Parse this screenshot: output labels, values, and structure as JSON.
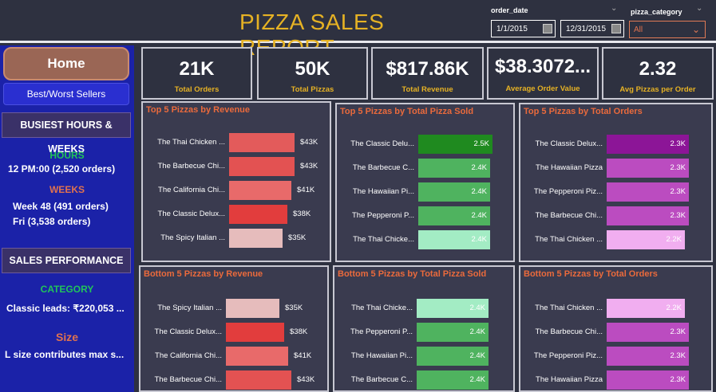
{
  "header": {
    "title": "PIZZA SALES REPORT",
    "order_date_label": "order_date",
    "date_start": "1/1/2015",
    "date_end": "12/31/2015",
    "category_label": "pizza_category",
    "category_value": "All"
  },
  "sidebar": {
    "home": "Home",
    "best_worst": "Best/Worst Sellers",
    "busiest": "BUSIEST HOURS & WEEKS",
    "hours_head": "HOURS",
    "hours_text": "12 PM:00 (2,520 orders)",
    "weeks_head": "WEEKS",
    "weeks_text1": "Week 48 (491 orders)",
    "weeks_text2": "Fri (3,538 orders)",
    "sales_perf": "SALES PERFORMANCE",
    "category_head": "CATEGORY",
    "category_text": "Classic leads: ₹220,053 ...",
    "size_head": "Size",
    "size_text": "L size contributes max s..."
  },
  "kpis": [
    {
      "value": "21K",
      "label": "Total Orders"
    },
    {
      "value": "50K",
      "label": "Total Pizzas"
    },
    {
      "value": "$817.86K",
      "label": "Total Revenue"
    },
    {
      "value": "$38.3072...",
      "label": "Average Order Value"
    },
    {
      "value": "2.32",
      "label": "Avg Pizzas per Order"
    }
  ],
  "chart_data": [
    {
      "type": "bar",
      "title": "Top 5 Pizzas by Revenue",
      "categories": [
        "The Thai Chicken ...",
        "The Barbecue Chi...",
        "The California Chi...",
        "The Classic Delux...",
        "The Spicy Italian ..."
      ],
      "values": [
        43,
        43,
        41,
        38,
        35
      ],
      "labels": [
        "$43K",
        "$43K",
        "$41K",
        "$38K",
        "$35K"
      ],
      "colors": [
        "#e35b5b",
        "#e35252",
        "#e86a6a",
        "#e23d3d",
        "#e6bcbc"
      ],
      "xlim": [
        0,
        45
      ]
    },
    {
      "type": "bar",
      "title": "Top 5 Pizzas by Total Pizza Sold",
      "categories": [
        "The Classic Delu...",
        "The Barbecue C...",
        "The Hawaiian Pi...",
        "The Pepperoni P...",
        "The Thai Chicke..."
      ],
      "values": [
        2.5,
        2.4,
        2.4,
        2.4,
        2.4
      ],
      "labels": [
        "2.5K",
        "2.4K",
        "2.4K",
        "2.4K",
        "2.4K"
      ],
      "colors": [
        "#1f8a1f",
        "#4fb35f",
        "#4fb35f",
        "#4fb35f",
        "#a3ecc4"
      ],
      "xlim": [
        0,
        2.6
      ]
    },
    {
      "type": "bar",
      "title": "Top 5 Pizzas by Total Orders",
      "categories": [
        "The Classic Delux...",
        "The Hawaiian Pizza",
        "The Pepperoni Piz...",
        "The Barbecue Chi...",
        "The Thai Chicken ..."
      ],
      "values": [
        2.3,
        2.3,
        2.3,
        2.3,
        2.2
      ],
      "labels": [
        "2.3K",
        "2.3K",
        "2.3K",
        "2.3K",
        "2.2K"
      ],
      "colors": [
        "#8c1597",
        "#bb4cc0",
        "#bb4cc0",
        "#bb4cc0",
        "#f1aef0"
      ],
      "xlim": [
        0,
        2.4
      ]
    },
    {
      "type": "bar",
      "title": "Bottom 5 Pizzas by Revenue",
      "categories": [
        "The Spicy Italian ...",
        "The Classic Delux...",
        "The California Chi...",
        "The Barbecue Chi..."
      ],
      "values": [
        35,
        38,
        41,
        43
      ],
      "labels": [
        "$35K",
        "$38K",
        "$41K",
        "$43K"
      ],
      "colors": [
        "#e6bcbc",
        "#e23d3d",
        "#e86a6a",
        "#e35252"
      ],
      "xlim": [
        0,
        45
      ]
    },
    {
      "type": "bar",
      "title": "Bottom 5 Pizzas by Total Pizza Sold",
      "categories": [
        "The Thai Chicke...",
        "The Pepperoni P...",
        "The Hawaiian Pi...",
        "The Barbecue C..."
      ],
      "values": [
        2.4,
        2.4,
        2.4,
        2.4
      ],
      "labels": [
        "2.4K",
        "2.4K",
        "2.4K",
        "2.4K"
      ],
      "colors": [
        "#a3ecc4",
        "#4fb35f",
        "#4fb35f",
        "#4fb35f"
      ],
      "xlim": [
        0,
        2.6
      ]
    },
    {
      "type": "bar",
      "title": "Bottom 5 Pizzas by Total Orders",
      "categories": [
        "The Thai Chicken ...",
        "The Barbecue Chi...",
        "The Pepperoni Piz...",
        "The Hawaiian Pizza"
      ],
      "values": [
        2.2,
        2.3,
        2.3,
        2.3
      ],
      "labels": [
        "2.2K",
        "2.3K",
        "2.3K",
        "2.3K"
      ],
      "colors": [
        "#f1aef0",
        "#bb4cc0",
        "#bb4cc0",
        "#bb4cc0"
      ],
      "xlim": [
        0,
        2.4
      ]
    }
  ]
}
